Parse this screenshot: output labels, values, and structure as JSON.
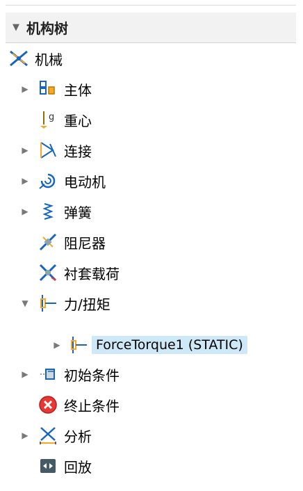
{
  "panel": {
    "title": "机构树"
  },
  "tree": {
    "root": {
      "label": "机械",
      "icon": "mechanism-icon"
    },
    "items": [
      {
        "label": "主体",
        "icon": "bodies-icon",
        "expandable": true,
        "expanded": false
      },
      {
        "label": "重心",
        "icon": "gravity-icon",
        "expandable": false
      },
      {
        "label": "连接",
        "icon": "connections-icon",
        "expandable": true,
        "expanded": false
      },
      {
        "label": "电动机",
        "icon": "motor-icon",
        "expandable": true,
        "expanded": false
      },
      {
        "label": "弹簧",
        "icon": "spring-icon",
        "expandable": true,
        "expanded": false
      },
      {
        "label": "阻尼器",
        "icon": "damper-icon",
        "expandable": false
      },
      {
        "label": "衬套载荷",
        "icon": "bushing-load-icon",
        "expandable": false
      },
      {
        "label": "力/扭矩",
        "icon": "force-torque-icon",
        "expandable": true,
        "expanded": true
      },
      {
        "label": "ForceTorque1 (STATIC)",
        "icon": "force-torque-icon",
        "expandable": true,
        "expanded": false,
        "selected": true,
        "child": true
      },
      {
        "label": "初始条件",
        "icon": "initial-conditions-icon",
        "expandable": true,
        "expanded": false
      },
      {
        "label": "终止条件",
        "icon": "termination-conditions-icon",
        "expandable": false
      },
      {
        "label": "分析",
        "icon": "analysis-icon",
        "expandable": true,
        "expanded": false
      },
      {
        "label": "回放",
        "icon": "playback-icon",
        "expandable": false
      }
    ]
  },
  "colors": {
    "selection": "#cde8f6",
    "header_bg": "#f2f2f2",
    "red": "#e53935",
    "blue": "#1565c0"
  }
}
